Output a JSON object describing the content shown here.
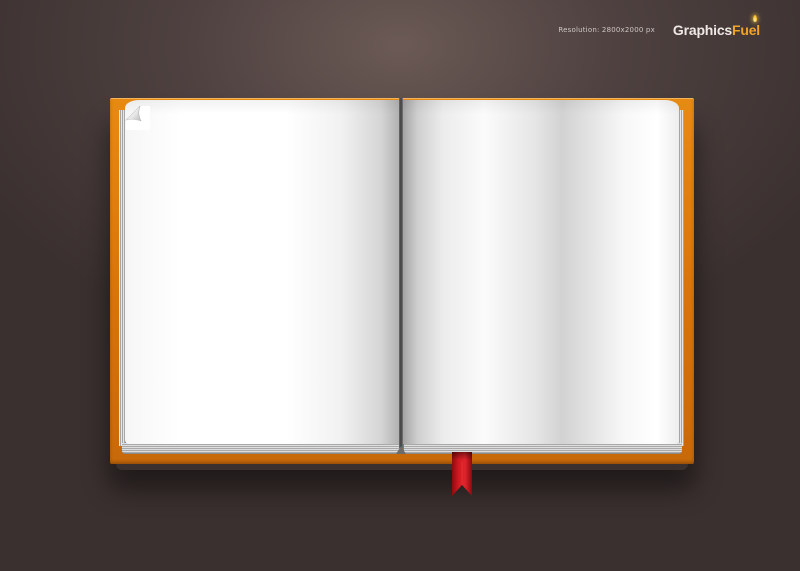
{
  "header": {
    "resolution": "Resolution: 2800x2000 px",
    "logo_main": "Graphics",
    "logo_accent": "Fuel"
  },
  "colors": {
    "background": "#4e4140",
    "cover": "#e08010",
    "page": "#ffffff",
    "bookmark": "#c4121a",
    "logo_accent": "#f0a528"
  },
  "icons": {
    "logo_flame": "candle-flame-icon",
    "page_curl": "page-curl-icon",
    "bookmark": "ribbon-bookmark-icon"
  }
}
